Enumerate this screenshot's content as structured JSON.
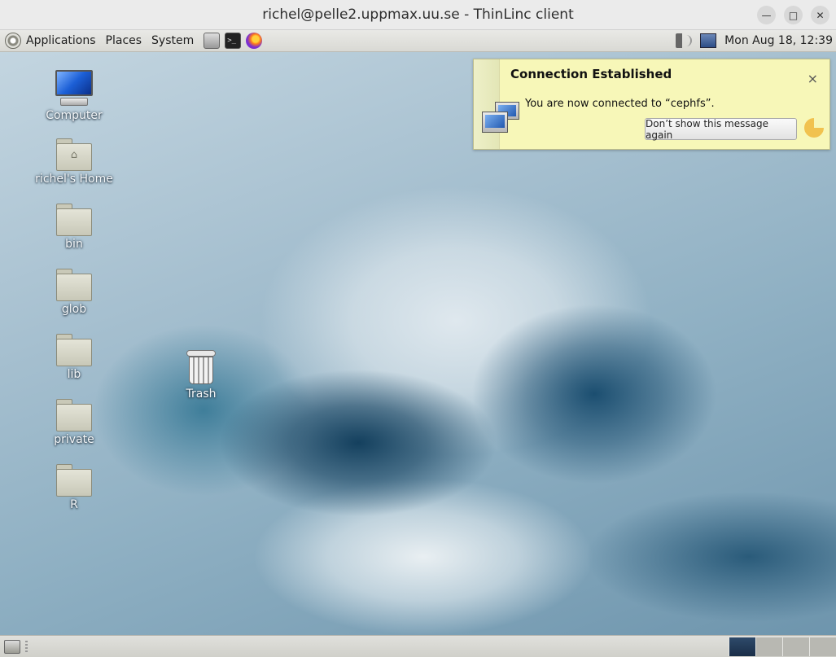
{
  "window": {
    "title": "richel@pelle2.uppmax.uu.se - ThinLinc client",
    "controls": [
      "minimize",
      "maximize",
      "close"
    ]
  },
  "top_panel": {
    "menus": [
      "Applications",
      "Places",
      "System"
    ],
    "launchers": [
      "file-manager-icon",
      "terminal-icon",
      "firefox-icon"
    ],
    "clock": "Mon Aug 18, 12:39"
  },
  "desktop": {
    "icons": [
      {
        "label": "Computer",
        "icon": "computer-icon"
      },
      {
        "label": "richel's Home",
        "icon": "home-folder-icon"
      },
      {
        "label": "bin",
        "icon": "folder-icon"
      },
      {
        "label": "glob",
        "icon": "folder-icon"
      },
      {
        "label": "lib",
        "icon": "folder-icon"
      },
      {
        "label": "private",
        "icon": "folder-icon"
      },
      {
        "label": "R",
        "icon": "folder-icon"
      },
      {
        "label": "Trash",
        "icon": "trash-icon"
      }
    ]
  },
  "notification": {
    "title": "Connection Established",
    "message": "You are now connected to “cephfs”.",
    "button": "Don’t show this message again",
    "close": "×"
  },
  "bottom_panel": {
    "workspace_count": 4,
    "active_workspace": 1
  }
}
